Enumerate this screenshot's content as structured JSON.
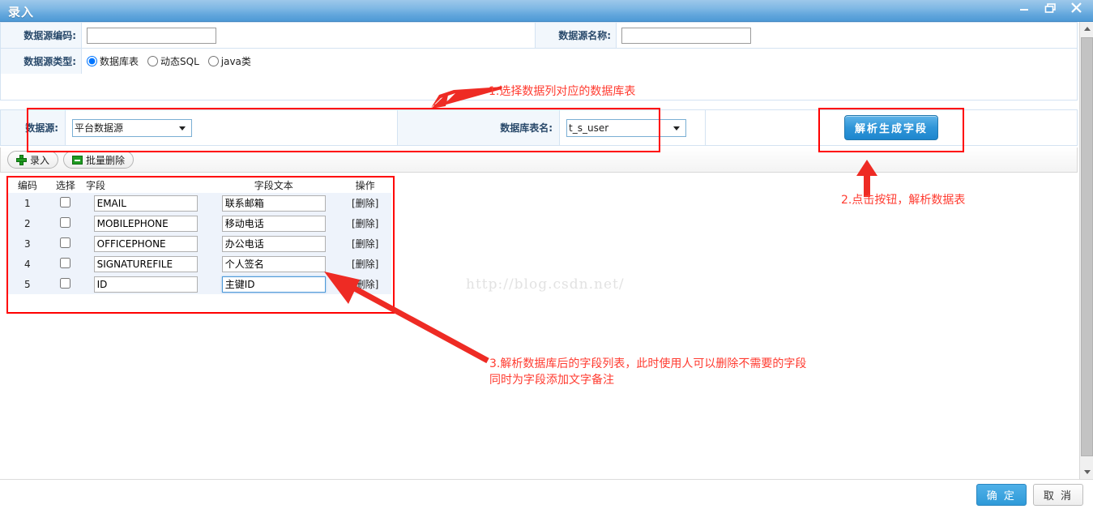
{
  "window": {
    "title": "录入",
    "controls": [
      {
        "name": "minimize",
        "glyph": "–"
      },
      {
        "name": "restore",
        "glyph": "❐"
      },
      {
        "name": "close",
        "glyph": "✕"
      }
    ]
  },
  "form": {
    "code_label": "数据源编码:",
    "code_value": "",
    "code_placeholder": "",
    "name_label": "数据源名称:",
    "name_value": "",
    "name_placeholder": "",
    "type_label": "数据源类型:",
    "type_options": [
      {
        "label": "数据库表",
        "selected": true
      },
      {
        "label": "动态SQL",
        "selected": false
      },
      {
        "label": "java类",
        "selected": false
      }
    ]
  },
  "datasource_row": {
    "ds_label": "数据源:",
    "ds_value": "平台数据源",
    "ds_options": [
      "平台数据源"
    ],
    "table_label": "数据库表名:",
    "table_value": "t_s_user",
    "table_options": [
      "t_s_user"
    ],
    "parse_button": "解析生成字段"
  },
  "toolbar": {
    "add_label": "录入",
    "batch_delete_label": "批量删除"
  },
  "grid": {
    "columns": [
      "编码",
      "选择",
      "字段",
      "字段文本",
      "操作"
    ],
    "delete_label": "[删除]",
    "rows": [
      {
        "no": "1",
        "checked": false,
        "field": "EMAIL",
        "text": "联系邮箱",
        "focused": false
      },
      {
        "no": "2",
        "checked": false,
        "field": "MOBILEPHONE",
        "text": "移动电话",
        "focused": false
      },
      {
        "no": "3",
        "checked": false,
        "field": "OFFICEPHONE",
        "text": "办公电话",
        "focused": false
      },
      {
        "no": "4",
        "checked": false,
        "field": "SIGNATUREFILE",
        "text": "个人签名",
        "focused": false
      },
      {
        "no": "5",
        "checked": false,
        "field": "ID",
        "text": "主键ID",
        "focused": true
      }
    ]
  },
  "annotations": {
    "step1": "1.选择数据列对应的数据库表",
    "step2": "2.点击按钮，解析数据表",
    "step3": "3.解析数据库后的字段列表，此时使用人可以删除不需要的字段\n同时为字段添加文字备注"
  },
  "watermark": "http://blog.csdn.net/",
  "footer": {
    "ok_label": "确 定",
    "cancel_label": "取 消"
  },
  "colors": {
    "title_bar": "#62a6dc",
    "accent": "#2f95d8",
    "annotation_red": "#ff3b30",
    "box_red": "#ff0000",
    "label_bg": "#f2f7fc",
    "grid_bg": "#eef3fb"
  }
}
